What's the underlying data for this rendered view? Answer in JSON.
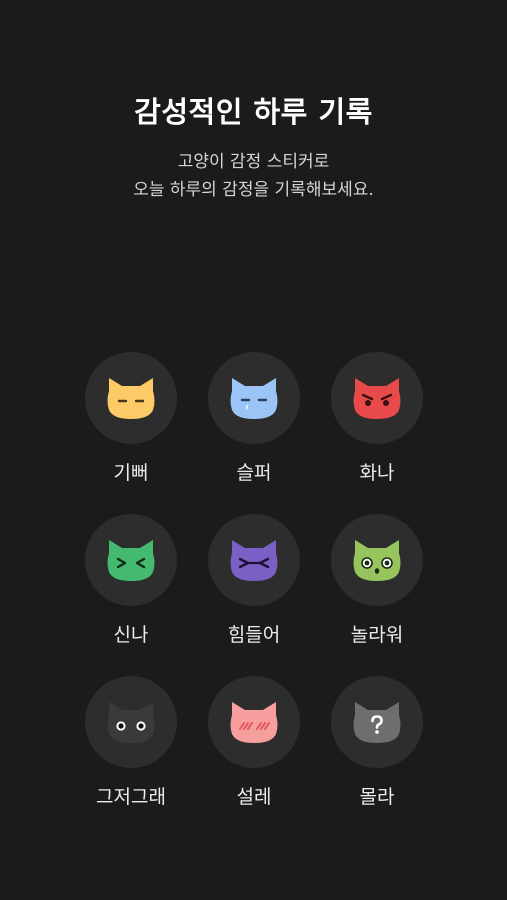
{
  "header": {
    "title": "감성적인 하루 기록",
    "subtitle_line1": "고양이 감정 스티커로",
    "subtitle_line2": "오늘 하루의 감정을 기록해보세요."
  },
  "emotions": [
    {
      "label": "기뻐",
      "icon": "happy-cat-icon",
      "color": "#FCCB68"
    },
    {
      "label": "슬퍼",
      "icon": "sad-cat-icon",
      "color": "#9BC4F7"
    },
    {
      "label": "화나",
      "icon": "angry-cat-icon",
      "color": "#E8494A"
    },
    {
      "label": "신나",
      "icon": "excited-cat-icon",
      "color": "#44BA71"
    },
    {
      "label": "힘들어",
      "icon": "tired-cat-icon",
      "color": "#7A5FC4"
    },
    {
      "label": "놀라워",
      "icon": "surprised-cat-icon",
      "color": "#98C45D"
    },
    {
      "label": "그저그래",
      "icon": "meh-cat-icon",
      "color": "#3A3A3A"
    },
    {
      "label": "설레",
      "icon": "fluttered-cat-icon",
      "color": "#F79E9E"
    },
    {
      "label": "몰라",
      "icon": "unknown-cat-icon",
      "color": "#6E6E6E"
    }
  ]
}
